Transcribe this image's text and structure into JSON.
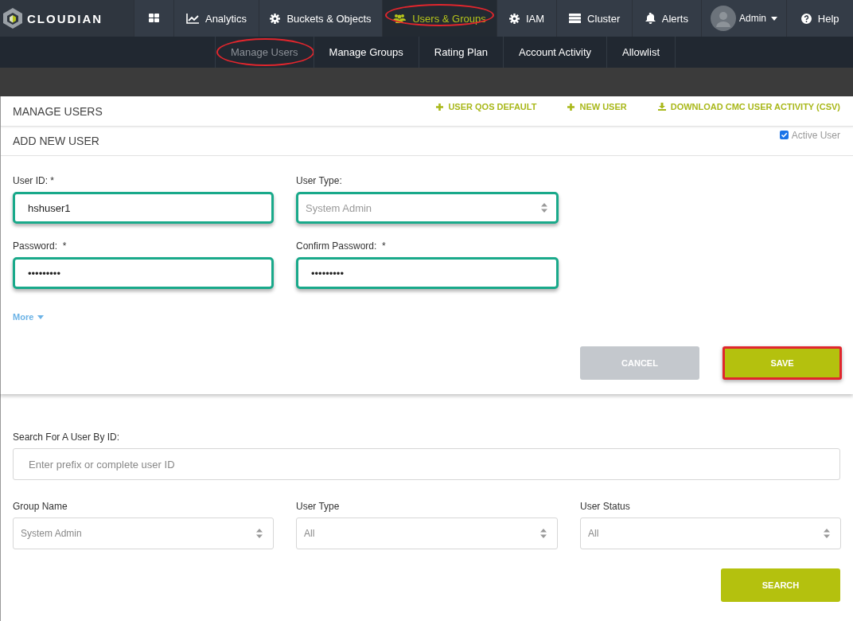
{
  "nav": {
    "logo": "CLOUDIAN",
    "items": [
      {
        "kind": "icon",
        "selected": false,
        "circled": false
      },
      {
        "kind": "link",
        "label": "Analytics",
        "selected": false,
        "circled": false
      },
      {
        "kind": "link",
        "label": "Buckets & Objects",
        "selected": false,
        "circled": false
      },
      {
        "kind": "link",
        "label": "Users & Groups",
        "selected": true,
        "circled": true
      },
      {
        "kind": "link",
        "label": "IAM",
        "selected": false,
        "circled": false
      },
      {
        "kind": "link",
        "label": "Cluster",
        "selected": false,
        "circled": false
      },
      {
        "kind": "link",
        "label": "Alerts",
        "selected": false,
        "circled": false
      },
      {
        "kind": "user-menu",
        "label": "Admin",
        "selected": false,
        "circled": false
      },
      {
        "kind": "link",
        "label": "Help",
        "selected": false,
        "circled": false
      }
    ]
  },
  "subnav": {
    "items": [
      {
        "label": "Manage Users",
        "selected": true,
        "circled": true
      },
      {
        "label": "Manage Groups",
        "selected": false,
        "circled": false
      },
      {
        "label": "Rating Plan",
        "selected": false,
        "circled": false
      },
      {
        "label": "Account Activity",
        "selected": false,
        "circled": false
      },
      {
        "label": "Allowlist",
        "selected": false,
        "circled": false
      }
    ]
  },
  "manage_users": {
    "title": "MANAGE USERS",
    "actions": [
      {
        "kind": "add",
        "label": "USER QOS DEFAULT"
      },
      {
        "kind": "add",
        "label": "NEW USER"
      },
      {
        "kind": "download",
        "label": "DOWNLOAD CMC USER ACTIVITY (CSV)"
      }
    ]
  },
  "add_user": {
    "title": "ADD NEW USER",
    "active_user": {
      "label": "Active User",
      "checked": true
    },
    "fields": [
      {
        "kind": "text",
        "label": "User ID: *",
        "value": "hshuser1",
        "highlighted": true,
        "disabled": false
      },
      {
        "kind": "select",
        "label": "User Type:",
        "value": "System Admin",
        "highlighted": true,
        "disabled": true
      },
      {
        "kind": "text",
        "label": "Password:  *",
        "value": "•••••••••",
        "highlighted": true,
        "disabled": false
      },
      {
        "kind": "text",
        "label": "Confirm Password:  *",
        "value": "•••••••••",
        "highlighted": true,
        "disabled": false
      }
    ],
    "more": "More",
    "buttons": [
      {
        "label": "CANCEL",
        "disabled": true,
        "circled": false
      },
      {
        "label": "SAVE",
        "disabled": false,
        "circled": true
      }
    ]
  },
  "search": {
    "label": "Search For A User By ID:",
    "placeholder": "Enter prefix or complete user ID",
    "filters": [
      {
        "label": "Group Name",
        "value": "System Admin"
      },
      {
        "label": "User Type",
        "value": "All"
      },
      {
        "label": "User Status",
        "value": "All"
      }
    ],
    "button": "SEARCH"
  }
}
